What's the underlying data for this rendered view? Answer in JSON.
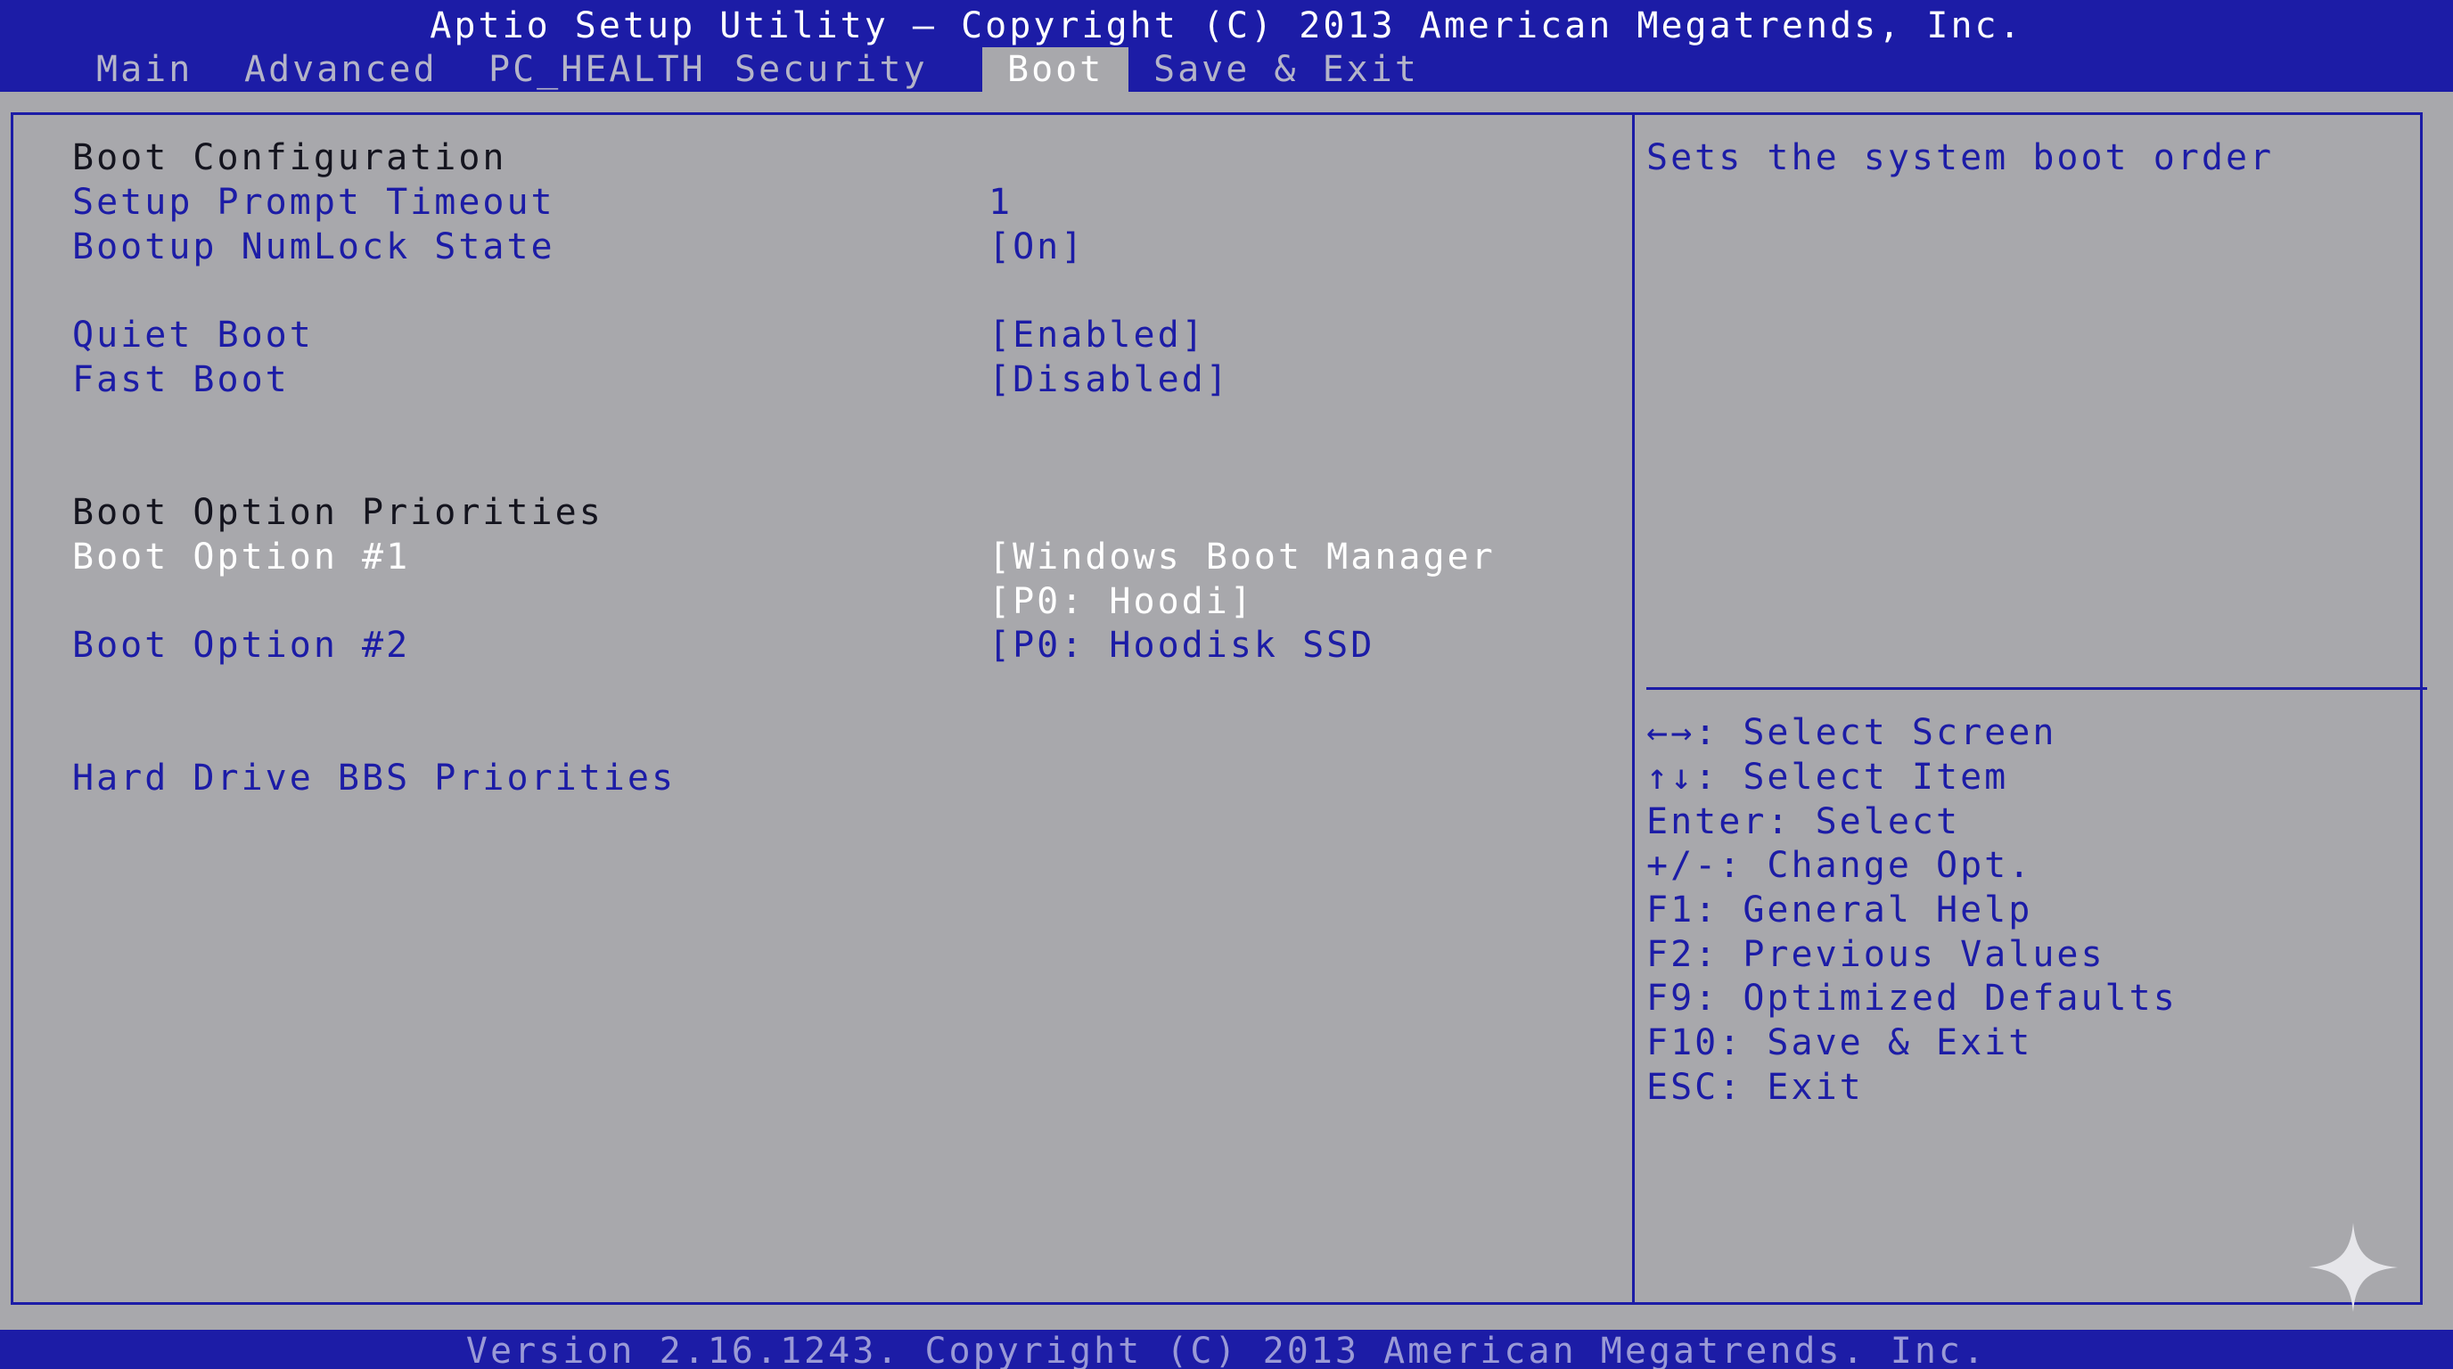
{
  "header": {
    "title": "Aptio Setup Utility – Copyright (C) 2013 American Megatrends, Inc.",
    "tabs": [
      "Main",
      "Advanced",
      "PC_HEALTH",
      "Security",
      "Boot",
      "Save & Exit"
    ],
    "active_tab": "Boot"
  },
  "main": {
    "boot_config_heading": "Boot Configuration",
    "setup_prompt_timeout": {
      "label": "Setup Prompt Timeout",
      "value": "1"
    },
    "bootup_numlock": {
      "label": "Bootup NumLock State",
      "value": "[On]"
    },
    "quiet_boot": {
      "label": "Quiet Boot",
      "value": "[Enabled]"
    },
    "fast_boot": {
      "label": "Fast Boot",
      "value": "[Disabled]"
    },
    "priorities_heading": "Boot Option Priorities",
    "boot_option_1": {
      "label": "Boot Option #1",
      "value_line1": "[Windows Boot Manager",
      "value_line2": "[P0: Hoodi]"
    },
    "boot_option_2": {
      "label": "Boot Option #2",
      "value": "[P0: Hoodisk SSD"
    },
    "hdd_bbs": {
      "label": "Hard Drive BBS Priorities"
    }
  },
  "help": {
    "description": "Sets the system boot order",
    "keys": [
      "←→: Select Screen",
      "↑↓: Select Item",
      "Enter: Select",
      "+/-: Change Opt.",
      "F1: General Help",
      "F2: Previous Values",
      "F9: Optimized Defaults",
      "F10: Save & Exit",
      "ESC: Exit"
    ]
  },
  "footer": {
    "version": "Version 2.16.1243. Copyright (C) 2013 American Megatrends. Inc."
  },
  "colors": {
    "bar_blue": "#1c1ca6",
    "panel_gray": "#a8a8ac",
    "selected_text": "#ffffff",
    "item_text": "#1c1ca6"
  },
  "icons": {
    "watermark": "sparkle-icon"
  }
}
